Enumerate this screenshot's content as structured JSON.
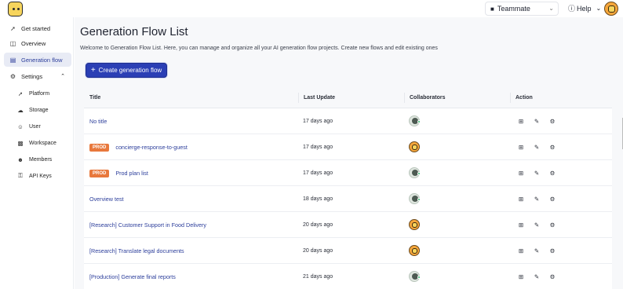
{
  "header": {
    "team_label": "Teammate",
    "help_label": "Help"
  },
  "sidebar": {
    "items": [
      {
        "label": "Get started",
        "icon": "rocket-icon"
      },
      {
        "label": "Overview",
        "icon": "layout-icon"
      },
      {
        "label": "Generation flow",
        "icon": "flow-icon",
        "active": true
      },
      {
        "label": "Settings",
        "icon": "gear-icon",
        "expanded": true
      }
    ],
    "settings_items": [
      {
        "label": "Platform",
        "icon": "platform-icon"
      },
      {
        "label": "Storage",
        "icon": "cloud-icon"
      },
      {
        "label": "User",
        "icon": "user-icon"
      },
      {
        "label": "Workspace",
        "icon": "workspace-icon"
      },
      {
        "label": "Members",
        "icon": "members-icon"
      },
      {
        "label": "API Keys",
        "icon": "key-icon"
      }
    ]
  },
  "main": {
    "title": "Generation Flow List",
    "description": "Welcome to Generation Flow List. Here, you can manage and organize all your AI generation flow projects. Create new flows and edit existing ones",
    "create_button": "Create generation flow"
  },
  "table": {
    "columns": [
      "Title",
      "Last Update",
      "Collaborators",
      "Action"
    ],
    "rows": [
      {
        "title": "No title",
        "badge": "",
        "last_update": "17 days ago",
        "avatar": "a"
      },
      {
        "title": "concierge-response-to-guest",
        "badge": "PROD",
        "last_update": "17 days ago",
        "avatar": "b"
      },
      {
        "title": "Prod plan list",
        "badge": "PROD",
        "last_update": "17 days ago",
        "avatar": "a"
      },
      {
        "title": "Overview test",
        "badge": "",
        "last_update": "18 days ago",
        "avatar": "a"
      },
      {
        "title": "[Research] Customer Support in Food Delivery",
        "badge": "",
        "last_update": "20 days ago",
        "avatar": "b"
      },
      {
        "title": "[Research] Translate legal documents",
        "badge": "",
        "last_update": "20 days ago",
        "avatar": "b"
      },
      {
        "title": "[Production] Generate final reports",
        "badge": "",
        "last_update": "21 days ago",
        "avatar": "a"
      }
    ],
    "action_icons": [
      "dashboard-icon",
      "edit-icon",
      "settings-icon"
    ]
  },
  "colors": {
    "accent": "#2b3fb5",
    "prod_badge": "#e8783c",
    "link": "#2c3e9b"
  }
}
